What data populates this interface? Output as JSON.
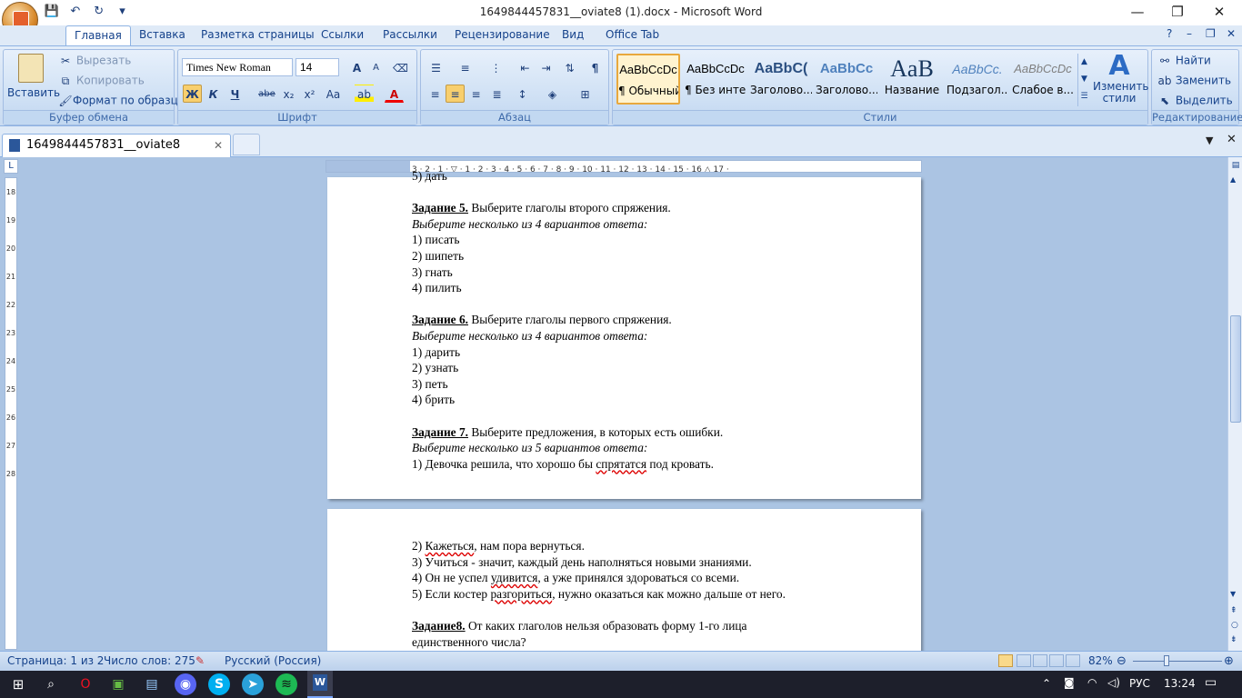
{
  "window": {
    "title": "1649844457831__oviate8 (1).docx - Microsoft Word",
    "minimize": "—",
    "restore": "❐",
    "close": "✕"
  },
  "qat": {
    "save": "💾",
    "undo": "↶",
    "redo": "↻",
    "customize": "▾"
  },
  "tabs": [
    "Главная",
    "Вставка",
    "Разметка страницы",
    "Ссылки",
    "Рассылки",
    "Рецензирование",
    "Вид",
    "Office Tab"
  ],
  "help_controls": {
    "help": "?",
    "min": "–",
    "restore": "❐",
    "close": "✕"
  },
  "clipboard": {
    "paste": "Вставить",
    "cut": "Вырезать",
    "copy": "Копировать",
    "format_painter": "Формат по образцу",
    "label": "Буфер обмена"
  },
  "font": {
    "name": "Times New Roman",
    "size": "14",
    "grow": "A",
    "shrink": "A",
    "bold": "Ж",
    "italic": "К",
    "underline": "Ч",
    "strike": "abe",
    "sub": "x₂",
    "sup": "x²",
    "case": "Aa",
    "color": "A",
    "label": "Шрифт"
  },
  "paragraph": {
    "label": "Абзац",
    "pilcrow": "¶"
  },
  "styles": {
    "label": "Стили",
    "items": [
      {
        "preview": "AaBbCcDc",
        "name": "¶ Обычный"
      },
      {
        "preview": "AaBbCcDc",
        "name": "¶ Без инте..."
      },
      {
        "preview": "AaBbC(",
        "name": "Заголово..."
      },
      {
        "preview": "AaBbCc",
        "name": "Заголово..."
      },
      {
        "preview": "AaB",
        "name": "Название"
      },
      {
        "preview": "AaBbCc.",
        "name": "Подзагол..."
      },
      {
        "preview": "AaBbCcDc",
        "name": "Слабое в..."
      }
    ],
    "change": "Изменить стили"
  },
  "editing": {
    "find": "Найти",
    "replace": "Заменить",
    "select": "Выделить",
    "label": "Редактирование"
  },
  "doc_tab": {
    "name": "1649844457831__oviate8 (1).docx",
    "close": "✕"
  },
  "ruler": {
    "h_marks": "3 · 2 · 1 · ▽ · 1 · 2 · 3 · 4 · 5 · 6 · 7 · 8 · 9 · 10 · 11 · 12 · 13 · 14 · 15 · 16 △ 17 ·",
    "v_marks": [
      "18",
      "19",
      "20",
      "21",
      "22",
      "23",
      "24",
      "25",
      "26",
      "27",
      "28"
    ]
  },
  "page1": {
    "top_fragment": "5) дать",
    "task5": {
      "head": "Задание 5.",
      "text": " Выберите глаголы второго спряжения.",
      "hint": "Выберите несколько из 4 вариантов ответа:",
      "options": [
        "1) писать",
        "2) шипеть",
        "3) гнать",
        "4) пилить"
      ]
    },
    "task6": {
      "head": "Задание 6.",
      "text": " Выберите глаголы первого спряжения.",
      "hint": "Выберите несколько из 4 вариантов ответа:",
      "options": [
        "1) дарить",
        "2) узнать",
        "3) петь",
        "4) брить"
      ]
    },
    "task7": {
      "head": "Задание 7.",
      "text": " Выберите предложения, в которых есть ошибки.",
      "hint": "Выберите несколько из 5 вариантов ответа:",
      "opt1_pre": "1) Девочка решила, что хорошо бы ",
      "opt1_err": "спрятатся",
      "opt1_post": " под кровать."
    }
  },
  "page2": {
    "o2_pre": "2) ",
    "o2_err": "Кажеться",
    "o2_post": ", нам пора вернуться.",
    "o3": "3) Учиться - значит, каждый день наполняться новыми знаниями.",
    "o4_pre": "4) Он не успел ",
    "o4_err": "удивится",
    "o4_post": ", а уже принялся здороваться со всеми.",
    "o5_pre": "5) Если костер ",
    "o5_err": "разгориться",
    "o5_post": ", нужно оказаться как можно дальше от него.",
    "task8_head": "Задание8.",
    "task8_text": " От каких глаголов нельзя образовать форму 1-го лица",
    "task8_line2": "единственного числа?"
  },
  "status": {
    "page": "Страница: 1 из 2",
    "words": "Число слов: 275",
    "lang": "Русский (Россия)",
    "zoom": "82%"
  },
  "taskbar": {
    "lang": "РУС",
    "time": "13:24"
  }
}
